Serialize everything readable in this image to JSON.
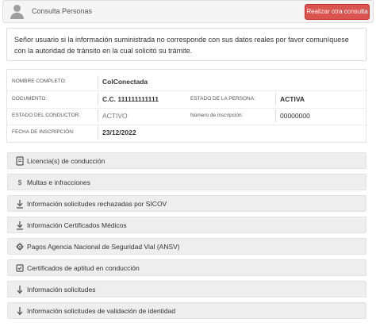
{
  "header": {
    "title": "Consulta Personas",
    "new_query_button": "Realizar otra consulta"
  },
  "notice": {
    "text": "Señor usuario si la información suministrada no corresponde con sus datos reales por favor comuníquese con la autoridad de tránsito en la cual solicitó su trámite."
  },
  "person": {
    "full_name_label": "NOMBRE COMPLETO:",
    "full_name_value": "ColConectada",
    "document_label": "DOCUMENTO:",
    "document_value": "C.C. 111111111111",
    "person_status_label": "ESTADO DE LA PERSONA:",
    "person_status_value": "ACTIVA",
    "driver_status_label": "ESTADO DEL CONDUCTOR:",
    "driver_status_value": "ACTIVO",
    "registration_number_label": "Número de inscripción:",
    "registration_number_value": "00000000",
    "registration_date_label": "FECHA DE INSCRIPCIÓN:",
    "registration_date_value": "23/12/2022"
  },
  "accordion": [
    {
      "icon": "license-icon",
      "label": "Licencia(s) de conducción"
    },
    {
      "icon": "dollar-icon",
      "label": "Multas e infracciones"
    },
    {
      "icon": "download-icon",
      "label": "Información solicitudes rechazadas por SICOV"
    },
    {
      "icon": "download-icon",
      "label": "Información Certificados Médicos"
    },
    {
      "icon": "gear-icon",
      "label": "Pagos Agencia Nacional de Seguridad Vial (ANSV)"
    },
    {
      "icon": "certificate-icon",
      "label": "Certificados de aptitud en conducción"
    },
    {
      "icon": "down-arrow-icon",
      "label": "Información solicitudes"
    },
    {
      "icon": "down-arrow-icon",
      "label": "Información solicitudes de validación de identidad"
    }
  ]
}
